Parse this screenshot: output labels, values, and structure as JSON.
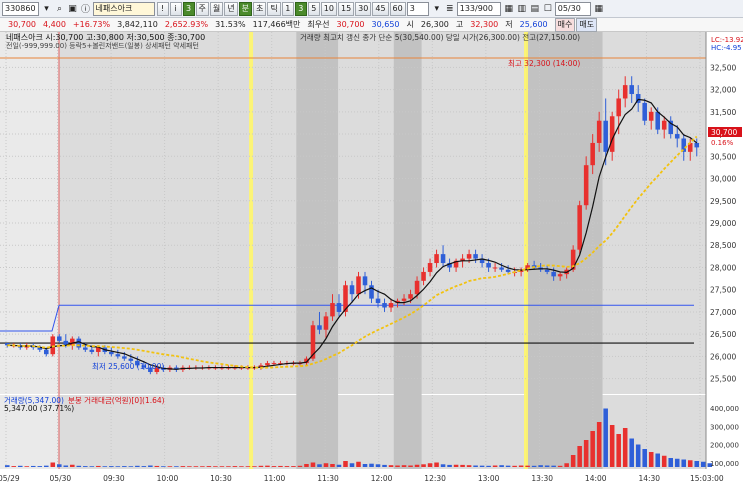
{
  "toolbar": {
    "code": "330860",
    "name": "네패스아크",
    "intervals": [
      "1",
      "3",
      "5",
      "10",
      "15",
      "30",
      "45",
      "60"
    ],
    "interval_value": "3",
    "count": "133/900",
    "date": "05/30",
    "btn_period_day": "주",
    "btn_period_week": "월",
    "btn_period_month": "년",
    "btn_type": "분",
    "btn_tick": "초",
    "btn_chart": "틱",
    "btn_search": "조회"
  },
  "quote": {
    "price": "30,700",
    "change": "4,400",
    "rate": "+16.73%",
    "volume": "3,842,110",
    "turnover": "2,652.93%",
    "ratio": "31.53%",
    "amount": "117,466백만",
    "sub_label": "최우선",
    "ask": "30,700",
    "bid": "30,650",
    "open_label": "시",
    "open": "26,300",
    "high_label": "고",
    "high": "32,300",
    "low_label": "저",
    "low": "25,600",
    "sell_label": "매수",
    "buy_label": "매도"
  },
  "chart_data": {
    "type": "candlestick",
    "title_line": "네패스아크 시:30,700 고:30,800 저:30,500 종:30,700",
    "legend_line": "거래량 최고치 갱신   종가 단순 5(30,540.00)   당일 시가(26,300.00)   전고(27,150.00)",
    "legend_line2": "전일(-999,999.00)   등락5+볼린저밴드(일봉) 상세패턴   약세패턴",
    "x_ticks": [
      "05/29",
      "05/30",
      "09:30",
      "10:00",
      "10:30",
      "11:00",
      "11:30",
      "12:00",
      "12:30",
      "13:00",
      "13:30",
      "14:00",
      "14:30",
      "15:03:00"
    ],
    "y_ticks": [
      32500,
      32000,
      31500,
      31000,
      30500,
      30000,
      29500,
      29000,
      28500,
      28000,
      27500,
      27000,
      26500,
      26000,
      25500
    ],
    "ylim": [
      25200,
      32800
    ],
    "price_tag": "30,700",
    "price_tag_pct": "0.16%",
    "lc_label": "LC:-13.92",
    "hc_label": "HC:-4.95",
    "high_annotation": "최고 32,300 (14:00)",
    "low_annotation": "최저 25,600 (10:00)",
    "reference_lines": {
      "blue": 27150,
      "black": 26300
    },
    "candles": [
      {
        "o": 26300,
        "h": 26300,
        "l": 26200,
        "c": 26250
      },
      {
        "o": 26250,
        "h": 26300,
        "l": 26200,
        "c": 26250
      },
      {
        "o": 26250,
        "h": 26300,
        "l": 26150,
        "c": 26200
      },
      {
        "o": 26200,
        "h": 26300,
        "l": 26150,
        "c": 26250
      },
      {
        "o": 26250,
        "h": 26300,
        "l": 26150,
        "c": 26200
      },
      {
        "o": 26200,
        "h": 26250,
        "l": 26100,
        "c": 26150
      },
      {
        "o": 26150,
        "h": 26200,
        "l": 26000,
        "c": 26050
      },
      {
        "o": 26050,
        "h": 26500,
        "l": 26000,
        "c": 26450
      },
      {
        "o": 26450,
        "h": 26500,
        "l": 26300,
        "c": 26350
      },
      {
        "o": 26350,
        "h": 26500,
        "l": 26200,
        "c": 26250
      },
      {
        "o": 26250,
        "h": 26450,
        "l": 26150,
        "c": 26400
      },
      {
        "o": 26400,
        "h": 26450,
        "l": 26150,
        "c": 26200
      },
      {
        "o": 26200,
        "h": 26300,
        "l": 26100,
        "c": 26150
      },
      {
        "o": 26150,
        "h": 26250,
        "l": 26050,
        "c": 26100
      },
      {
        "o": 26100,
        "h": 26250,
        "l": 26000,
        "c": 26200
      },
      {
        "o": 26200,
        "h": 26250,
        "l": 26050,
        "c": 26100
      },
      {
        "o": 26100,
        "h": 26200,
        "l": 26000,
        "c": 26050
      },
      {
        "o": 26050,
        "h": 26150,
        "l": 25950,
        "c": 26000
      },
      {
        "o": 26000,
        "h": 26100,
        "l": 25900,
        "c": 25950
      },
      {
        "o": 25950,
        "h": 26050,
        "l": 25850,
        "c": 25900
      },
      {
        "o": 25900,
        "h": 26000,
        "l": 25750,
        "c": 25800
      },
      {
        "o": 25800,
        "h": 25900,
        "l": 25700,
        "c": 25750
      },
      {
        "o": 25750,
        "h": 25800,
        "l": 25600,
        "c": 25650
      },
      {
        "o": 25650,
        "h": 25800,
        "l": 25600,
        "c": 25750
      },
      {
        "o": 25750,
        "h": 25800,
        "l": 25650,
        "c": 25700
      },
      {
        "o": 25700,
        "h": 25800,
        "l": 25650,
        "c": 25750
      },
      {
        "o": 25750,
        "h": 25800,
        "l": 25650,
        "c": 25700
      },
      {
        "o": 25700,
        "h": 25800,
        "l": 25650,
        "c": 25750
      },
      {
        "o": 25750,
        "h": 25800,
        "l": 25700,
        "c": 25750
      },
      {
        "o": 25750,
        "h": 25800,
        "l": 25700,
        "c": 25750
      },
      {
        "o": 25750,
        "h": 25800,
        "l": 25700,
        "c": 25750
      },
      {
        "o": 25750,
        "h": 25800,
        "l": 25700,
        "c": 25750
      },
      {
        "o": 25750,
        "h": 25800,
        "l": 25700,
        "c": 25750
      },
      {
        "o": 25750,
        "h": 25800,
        "l": 25700,
        "c": 25750
      },
      {
        "o": 25750,
        "h": 25800,
        "l": 25700,
        "c": 25750
      },
      {
        "o": 25750,
        "h": 25800,
        "l": 25700,
        "c": 25750
      },
      {
        "o": 25750,
        "h": 25800,
        "l": 25700,
        "c": 25750
      },
      {
        "o": 25750,
        "h": 25800,
        "l": 25700,
        "c": 25750
      },
      {
        "o": 25750,
        "h": 25800,
        "l": 25700,
        "c": 25750
      },
      {
        "o": 25750,
        "h": 25850,
        "l": 25700,
        "c": 25800
      },
      {
        "o": 25800,
        "h": 25900,
        "l": 25750,
        "c": 25850
      },
      {
        "o": 25850,
        "h": 25900,
        "l": 25800,
        "c": 25850
      },
      {
        "o": 25850,
        "h": 25900,
        "l": 25800,
        "c": 25850
      },
      {
        "o": 25850,
        "h": 25900,
        "l": 25800,
        "c": 25850
      },
      {
        "o": 25850,
        "h": 25900,
        "l": 25800,
        "c": 25850
      },
      {
        "o": 25850,
        "h": 25900,
        "l": 25800,
        "c": 25850
      },
      {
        "o": 25850,
        "h": 26000,
        "l": 25800,
        "c": 25950
      },
      {
        "o": 25950,
        "h": 26800,
        "l": 25900,
        "c": 26700
      },
      {
        "o": 26700,
        "h": 27000,
        "l": 26500,
        "c": 26600
      },
      {
        "o": 26600,
        "h": 27000,
        "l": 26400,
        "c": 26900
      },
      {
        "o": 26900,
        "h": 27400,
        "l": 26800,
        "c": 27200
      },
      {
        "o": 27200,
        "h": 27400,
        "l": 26900,
        "c": 27000
      },
      {
        "o": 27000,
        "h": 27700,
        "l": 26900,
        "c": 27600
      },
      {
        "o": 27600,
        "h": 27700,
        "l": 27200,
        "c": 27400
      },
      {
        "o": 27400,
        "h": 27900,
        "l": 27300,
        "c": 27800
      },
      {
        "o": 27800,
        "h": 27900,
        "l": 27400,
        "c": 27600
      },
      {
        "o": 27600,
        "h": 27700,
        "l": 27200,
        "c": 27300
      },
      {
        "o": 27300,
        "h": 27500,
        "l": 27100,
        "c": 27200
      },
      {
        "o": 27200,
        "h": 27300,
        "l": 27000,
        "c": 27100
      },
      {
        "o": 27100,
        "h": 27300,
        "l": 27000,
        "c": 27200
      },
      {
        "o": 27200,
        "h": 27300,
        "l": 27100,
        "c": 27250
      },
      {
        "o": 27250,
        "h": 27400,
        "l": 27150,
        "c": 27300
      },
      {
        "o": 27300,
        "h": 27500,
        "l": 27200,
        "c": 27400
      },
      {
        "o": 27400,
        "h": 27800,
        "l": 27300,
        "c": 27700
      },
      {
        "o": 27700,
        "h": 28000,
        "l": 27600,
        "c": 27900
      },
      {
        "o": 27900,
        "h": 28200,
        "l": 27800,
        "c": 28100
      },
      {
        "o": 28100,
        "h": 28400,
        "l": 28000,
        "c": 28300
      },
      {
        "o": 28300,
        "h": 28500,
        "l": 28000,
        "c": 28100
      },
      {
        "o": 28100,
        "h": 28200,
        "l": 27900,
        "c": 28000
      },
      {
        "o": 28000,
        "h": 28200,
        "l": 27900,
        "c": 28150
      },
      {
        "o": 28150,
        "h": 28300,
        "l": 28000,
        "c": 28200
      },
      {
        "o": 28200,
        "h": 28400,
        "l": 28100,
        "c": 28300
      },
      {
        "o": 28300,
        "h": 28400,
        "l": 28100,
        "c": 28200
      },
      {
        "o": 28200,
        "h": 28300,
        "l": 28000,
        "c": 28100
      },
      {
        "o": 28100,
        "h": 28200,
        "l": 27900,
        "c": 28000
      },
      {
        "o": 28000,
        "h": 28100,
        "l": 27900,
        "c": 28000
      },
      {
        "o": 28000,
        "h": 28100,
        "l": 27900,
        "c": 27950
      },
      {
        "o": 27950,
        "h": 28050,
        "l": 27850,
        "c": 27900
      },
      {
        "o": 27900,
        "h": 28000,
        "l": 27800,
        "c": 27900
      },
      {
        "o": 27900,
        "h": 28000,
        "l": 27800,
        "c": 27950
      },
      {
        "o": 27950,
        "h": 28100,
        "l": 27900,
        "c": 28050
      },
      {
        "o": 28050,
        "h": 28150,
        "l": 27950,
        "c": 28000
      },
      {
        "o": 28000,
        "h": 28100,
        "l": 27900,
        "c": 27950
      },
      {
        "o": 27950,
        "h": 28050,
        "l": 27850,
        "c": 27900
      },
      {
        "o": 27900,
        "h": 28000,
        "l": 27700,
        "c": 27800
      },
      {
        "o": 27800,
        "h": 27900,
        "l": 27700,
        "c": 27850
      },
      {
        "o": 27850,
        "h": 28000,
        "l": 27750,
        "c": 27950
      },
      {
        "o": 27950,
        "h": 28500,
        "l": 27900,
        "c": 28400
      },
      {
        "o": 28400,
        "h": 29500,
        "l": 28300,
        "c": 29400
      },
      {
        "o": 29400,
        "h": 30500,
        "l": 29300,
        "c": 30300
      },
      {
        "o": 30300,
        "h": 31000,
        "l": 30100,
        "c": 30800
      },
      {
        "o": 30800,
        "h": 31500,
        "l": 30600,
        "c": 31300
      },
      {
        "o": 31300,
        "h": 31800,
        "l": 30300,
        "c": 30600
      },
      {
        "o": 30600,
        "h": 31500,
        "l": 30400,
        "c": 31400
      },
      {
        "o": 31400,
        "h": 32000,
        "l": 31000,
        "c": 31800
      },
      {
        "o": 31800,
        "h": 32300,
        "l": 31600,
        "c": 32100
      },
      {
        "o": 32100,
        "h": 32300,
        "l": 31700,
        "c": 31900
      },
      {
        "o": 31900,
        "h": 32100,
        "l": 31500,
        "c": 31700
      },
      {
        "o": 31700,
        "h": 31800,
        "l": 31200,
        "c": 31300
      },
      {
        "o": 31300,
        "h": 31600,
        "l": 31100,
        "c": 31500
      },
      {
        "o": 31500,
        "h": 31600,
        "l": 31000,
        "c": 31100
      },
      {
        "o": 31100,
        "h": 31400,
        "l": 30900,
        "c": 31300
      },
      {
        "o": 31300,
        "h": 31400,
        "l": 30900,
        "c": 31000
      },
      {
        "o": 31000,
        "h": 31200,
        "l": 30700,
        "c": 30900
      },
      {
        "o": 30900,
        "h": 31000,
        "l": 30400,
        "c": 30600
      },
      {
        "o": 30600,
        "h": 30900,
        "l": 30400,
        "c": 30800
      },
      {
        "o": 30800,
        "h": 30900,
        "l": 30500,
        "c": 30700
      }
    ],
    "volume_ticks": [
      "400,000",
      "300,000",
      "200,000",
      "100,000"
    ],
    "volume_label": "거래량(5,347.00)",
    "volume_sub": "5,347.00 (37.71%)",
    "amount_label": "분봉 거래대금(억원)[0](1.64)",
    "volumes": [
      12,
      6,
      8,
      5,
      7,
      6,
      9,
      30,
      18,
      10,
      15,
      8,
      6,
      5,
      7,
      5,
      6,
      5,
      6,
      5,
      8,
      6,
      10,
      7,
      5,
      5,
      5,
      6,
      5,
      5,
      5,
      6,
      5,
      5,
      5,
      6,
      5,
      5,
      5,
      8,
      9,
      6,
      7,
      6,
      6,
      8,
      20,
      30,
      18,
      25,
      20,
      15,
      40,
      25,
      35,
      20,
      22,
      18,
      14,
      12,
      10,
      12,
      10,
      15,
      18,
      25,
      30,
      18,
      14,
      15,
      14,
      12,
      10,
      9,
      8,
      10,
      12,
      9,
      8,
      10,
      9,
      8,
      12,
      10,
      9,
      8,
      25,
      80,
      140,
      180,
      240,
      300,
      390,
      280,
      220,
      260,
      190,
      150,
      120,
      100,
      90,
      75,
      60,
      55,
      50,
      45,
      40,
      35,
      25
    ]
  }
}
